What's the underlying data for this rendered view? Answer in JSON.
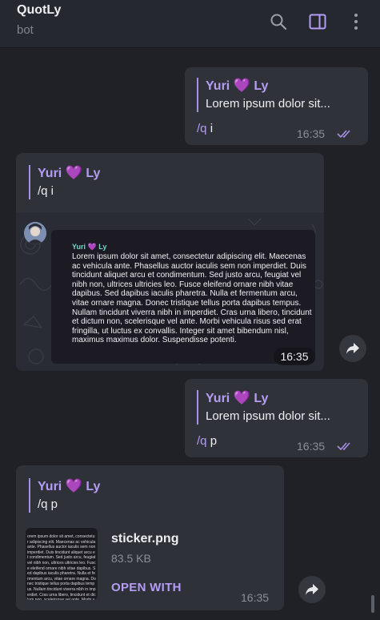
{
  "header": {
    "title": "QuotLy",
    "subtitle": "bot",
    "icons": [
      "search-icon",
      "side-panel-icon",
      "more-icon"
    ]
  },
  "colors": {
    "accent": "#b59cf4",
    "heart": "#a03de0",
    "bubble": "#2e3137",
    "background": "#1f2126",
    "quote_name": "#77d6cc"
  },
  "messages": [
    {
      "direction": "outgoing",
      "reply_name": "Yuri",
      "reply_name_suffix": "Ly",
      "reply_text": "Lorem ipsum dolor sit...",
      "cmd": "/q",
      "arg": "i",
      "time": "16:35",
      "status": "read"
    },
    {
      "direction": "incoming",
      "reply_name": "Yuri",
      "reply_name_suffix": "Ly",
      "reply_text": "/q i",
      "sticker": {
        "name": "Yuri",
        "name_suffix": "Ly",
        "text": "Lorem ipsum dolor sit amet, consectetur adipiscing elit. Maecenas ac vehicula ante. Phasellus auctor iaculis sem non imperdiet. Duis tincidunt aliquet arcu et condimentum. Sed justo arcu, feugiat vel nibh non, ultrices ultricies leo. Fusce eleifend ornare nibh vitae dapibus. Sed dapibus iaculis pharetra. Nulla et fermentum arcu, vitae ornare magna. Donec tristique tellus porta dapibus tempus. Nullam tincidunt viverra nibh in imperdiet. Cras urna libero, tincidunt et dictum non, scelerisque vel ante. Morbi vehicula risus sed erat fringilla, ut luctus ex convallis. Integer sit amet bibendum nisl, maximus maximus dolor. Suspendisse potenti.",
        "time": "16:35"
      }
    },
    {
      "direction": "outgoing",
      "reply_name": "Yuri",
      "reply_name_suffix": "Ly",
      "reply_text": "Lorem ipsum dolor sit...",
      "cmd": "/q",
      "arg": "p",
      "time": "16:35",
      "status": "read"
    },
    {
      "direction": "incoming",
      "reply_name": "Yuri",
      "reply_name_suffix": "Ly",
      "reply_text": "/q p",
      "file": {
        "name": "sticker.png",
        "size": "83.5 KB",
        "action": "OPEN WITH",
        "time": "16:35",
        "thumb_text": "orem ipsum dolor sit amet, consectetur adipiscing elit. Maecenas ac vehicula ante. Phasellus auctor iaculis sem non imperdiet. Duis tincidunt aliquet arcu et condimentum. Sed justo arcu, feugiat vel nibh non, ultrices ultricies leo. Fusce eleifend ornare nibh vitae dapibus. Sed dapibus iaculis pharetra. Nulla et fermentum arcu, vitae ornare magna. Donec tristique tellus porta dapibus tempus. Nullam tincidunt viverra nibh in imperdiet. Cras urna libero, tincidunt et dictum non, scelerisque vel ante. Morbi vehicula risus sed erat fringilla, ut luctus ex convallis. Integer sit amet bibendum nisl, maximus maximus dolor. Suspendisse potenti."
      }
    }
  ]
}
